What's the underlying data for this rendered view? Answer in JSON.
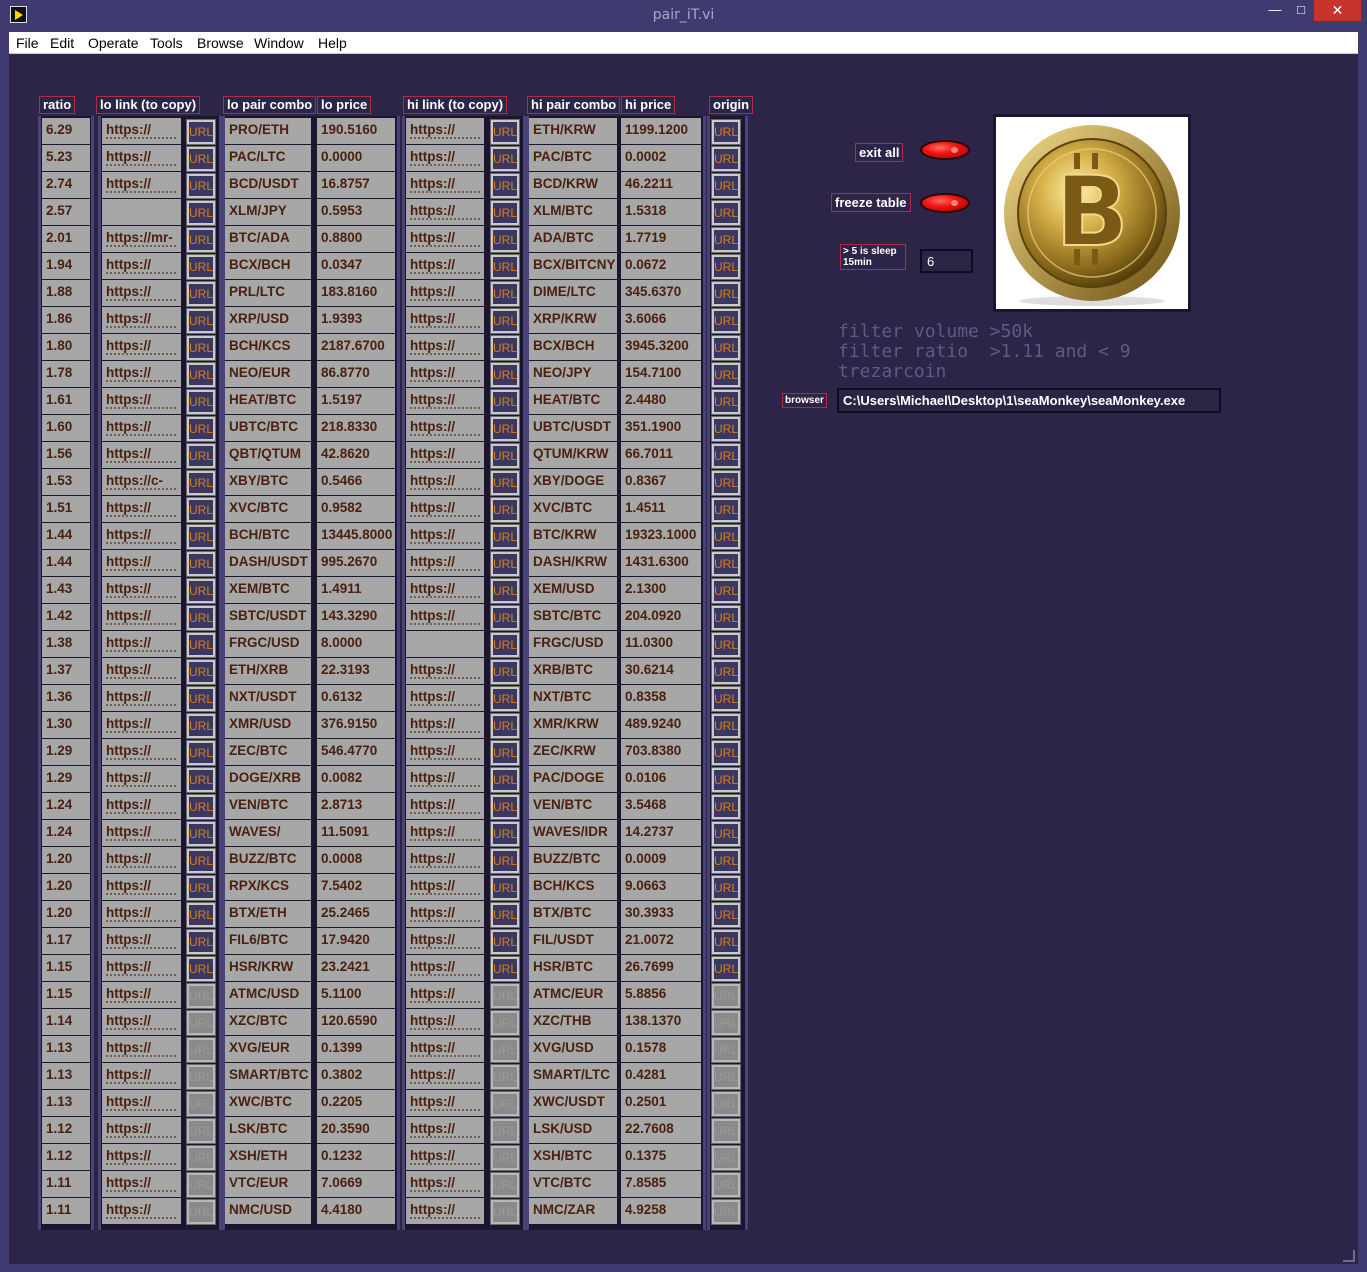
{
  "window": {
    "title": "pair_iT.vi",
    "minimize": "—",
    "maximize": "□",
    "close": "✕"
  },
  "menu": [
    "File",
    "Edit",
    "Operate",
    "Tools",
    "Browse",
    "Window",
    "Help"
  ],
  "columns": {
    "ratio": "ratio",
    "lo_link": "lo link (to copy)",
    "lo_pair": "lo pair combo",
    "lo_price": "lo price",
    "hi_link": "hi link (to copy)",
    "hi_pair": "hi pair combo",
    "hi_price": "hi price",
    "origin": "origin"
  },
  "url_label": "URL",
  "rows": [
    {
      "ratio": "6.29",
      "lo_link": "https://",
      "lo_pair": "PRO/ETH",
      "lo_price": "190.5160",
      "hi_link": "https://",
      "hi_pair": "ETH/KRW",
      "hi_price": "1199.1200",
      "active": true
    },
    {
      "ratio": "5.23",
      "lo_link": "https://",
      "lo_pair": "PAC/LTC",
      "lo_price": "0.0000",
      "hi_link": "https://",
      "hi_pair": "PAC/BTC",
      "hi_price": "0.0002",
      "active": true
    },
    {
      "ratio": "2.74",
      "lo_link": "https://",
      "lo_pair": "BCD/USDT",
      "lo_price": "16.8757",
      "hi_link": "https://",
      "hi_pair": "BCD/KRW",
      "hi_price": "46.2211",
      "active": true
    },
    {
      "ratio": "2.57",
      "lo_link": "",
      "lo_pair": "XLM/JPY",
      "lo_price": "0.5953",
      "hi_link": "https://",
      "hi_pair": "XLM/BTC",
      "hi_price": "1.5318",
      "active": true
    },
    {
      "ratio": "2.01",
      "lo_link": "https://mr-",
      "lo_pair": "BTC/ADA",
      "lo_price": "0.8800",
      "hi_link": "https://",
      "hi_pair": "ADA/BTC",
      "hi_price": "1.7719",
      "active": true
    },
    {
      "ratio": "1.94",
      "lo_link": "https://",
      "lo_pair": "BCX/BCH",
      "lo_price": "0.0347",
      "hi_link": "https://",
      "hi_pair": "BCX/BITCNY",
      "hi_price": "0.0672",
      "active": true
    },
    {
      "ratio": "1.88",
      "lo_link": "https://",
      "lo_pair": "PRL/LTC",
      "lo_price": "183.8160",
      "hi_link": "https://",
      "hi_pair": "DIME/LTC",
      "hi_price": "345.6370",
      "active": true
    },
    {
      "ratio": "1.86",
      "lo_link": "https://",
      "lo_pair": "XRP/USD",
      "lo_price": "1.9393",
      "hi_link": "https://",
      "hi_pair": "XRP/KRW",
      "hi_price": "3.6066",
      "active": true
    },
    {
      "ratio": "1.80",
      "lo_link": "https://",
      "lo_pair": "BCH/KCS",
      "lo_price": "2187.6700",
      "hi_link": "https://",
      "hi_pair": "BCX/BCH",
      "hi_price": "3945.3200",
      "active": true
    },
    {
      "ratio": "1.78",
      "lo_link": "https://",
      "lo_pair": "NEO/EUR",
      "lo_price": "86.8770",
      "hi_link": "https://",
      "hi_pair": "NEO/JPY",
      "hi_price": "154.7100",
      "active": true
    },
    {
      "ratio": "1.61",
      "lo_link": "https://",
      "lo_pair": "HEAT/BTC",
      "lo_price": "1.5197",
      "hi_link": "https://",
      "hi_pair": "HEAT/BTC",
      "hi_price": "2.4480",
      "active": true
    },
    {
      "ratio": "1.60",
      "lo_link": "https://",
      "lo_pair": "UBTC/BTC",
      "lo_price": "218.8330",
      "hi_link": "https://",
      "hi_pair": "UBTC/USDT",
      "hi_price": "351.1900",
      "active": true
    },
    {
      "ratio": "1.56",
      "lo_link": "https://",
      "lo_pair": "QBT/QTUM",
      "lo_price": "42.8620",
      "hi_link": "https://",
      "hi_pair": "QTUM/KRW",
      "hi_price": "66.7011",
      "active": true
    },
    {
      "ratio": "1.53",
      "lo_link": "https://c-",
      "lo_pair": "XBY/BTC",
      "lo_price": "0.5466",
      "hi_link": "https://",
      "hi_pair": "XBY/DOGE",
      "hi_price": "0.8367",
      "active": true
    },
    {
      "ratio": "1.51",
      "lo_link": "https://",
      "lo_pair": "XVC/BTC",
      "lo_price": "0.9582",
      "hi_link": "https://",
      "hi_pair": "XVC/BTC",
      "hi_price": "1.4511",
      "active": true
    },
    {
      "ratio": "1.44",
      "lo_link": "https://",
      "lo_pair": "BCH/BTC",
      "lo_price": "13445.8000",
      "hi_link": "https://",
      "hi_pair": "BTC/KRW",
      "hi_price": "19323.1000",
      "active": true
    },
    {
      "ratio": "1.44",
      "lo_link": "https://",
      "lo_pair": "DASH/USDT",
      "lo_price": "995.2670",
      "hi_link": "https://",
      "hi_pair": "DASH/KRW",
      "hi_price": "1431.6300",
      "active": true
    },
    {
      "ratio": "1.43",
      "lo_link": "https://",
      "lo_pair": "XEM/BTC",
      "lo_price": "1.4911",
      "hi_link": "https://",
      "hi_pair": "XEM/USD",
      "hi_price": "2.1300",
      "active": true
    },
    {
      "ratio": "1.42",
      "lo_link": "https://",
      "lo_pair": "SBTC/USDT",
      "lo_price": "143.3290",
      "hi_link": "https://",
      "hi_pair": "SBTC/BTC",
      "hi_price": "204.0920",
      "active": true
    },
    {
      "ratio": "1.38",
      "lo_link": "https://",
      "lo_pair": "FRGC/USD",
      "lo_price": "8.0000",
      "hi_link": "",
      "hi_pair": "FRGC/USD",
      "hi_price": "11.0300",
      "active": true
    },
    {
      "ratio": "1.37",
      "lo_link": "https://",
      "lo_pair": "ETH/XRB",
      "lo_price": "22.3193",
      "hi_link": "https://",
      "hi_pair": "XRB/BTC",
      "hi_price": "30.6214",
      "active": true
    },
    {
      "ratio": "1.36",
      "lo_link": "https://",
      "lo_pair": "NXT/USDT",
      "lo_price": "0.6132",
      "hi_link": "https://",
      "hi_pair": "NXT/BTC",
      "hi_price": "0.8358",
      "active": true
    },
    {
      "ratio": "1.30",
      "lo_link": "https://",
      "lo_pair": "XMR/USD",
      "lo_price": "376.9150",
      "hi_link": "https://",
      "hi_pair": "XMR/KRW",
      "hi_price": "489.9240",
      "active": true
    },
    {
      "ratio": "1.29",
      "lo_link": "https://",
      "lo_pair": "ZEC/BTC",
      "lo_price": "546.4770",
      "hi_link": "https://",
      "hi_pair": "ZEC/KRW",
      "hi_price": "703.8380",
      "active": true
    },
    {
      "ratio": "1.29",
      "lo_link": "https://",
      "lo_pair": "DOGE/XRB",
      "lo_price": "0.0082",
      "hi_link": "https://",
      "hi_pair": "PAC/DOGE",
      "hi_price": "0.0106",
      "active": true
    },
    {
      "ratio": "1.24",
      "lo_link": "https://",
      "lo_pair": "VEN/BTC",
      "lo_price": "2.8713",
      "hi_link": "https://",
      "hi_pair": "VEN/BTC",
      "hi_price": "3.5468",
      "active": true
    },
    {
      "ratio": "1.24",
      "lo_link": "https://",
      "lo_pair": "WAVES/",
      "lo_price": "11.5091",
      "hi_link": "https://",
      "hi_pair": "WAVES/IDR",
      "hi_price": "14.2737",
      "active": true
    },
    {
      "ratio": "1.20",
      "lo_link": "https://",
      "lo_pair": "BUZZ/BTC",
      "lo_price": "0.0008",
      "hi_link": "https://",
      "hi_pair": "BUZZ/BTC",
      "hi_price": "0.0009",
      "active": true
    },
    {
      "ratio": "1.20",
      "lo_link": "https://",
      "lo_pair": "RPX/KCS",
      "lo_price": "7.5402",
      "hi_link": "https://",
      "hi_pair": "BCH/KCS",
      "hi_price": "9.0663",
      "active": true
    },
    {
      "ratio": "1.20",
      "lo_link": "https://",
      "lo_pair": "BTX/ETH",
      "lo_price": "25.2465",
      "hi_link": "https://",
      "hi_pair": "BTX/BTC",
      "hi_price": "30.3933",
      "active": true
    },
    {
      "ratio": "1.17",
      "lo_link": "https://",
      "lo_pair": "FIL6/BTC",
      "lo_price": "17.9420",
      "hi_link": "https://",
      "hi_pair": "FIL/USDT",
      "hi_price": "21.0072",
      "active": true
    },
    {
      "ratio": "1.15",
      "lo_link": "https://",
      "lo_pair": "HSR/KRW",
      "lo_price": "23.2421",
      "hi_link": "https://",
      "hi_pair": "HSR/BTC",
      "hi_price": "26.7699",
      "active": true
    },
    {
      "ratio": "1.15",
      "lo_link": "https://",
      "lo_pair": "ATMC/USD",
      "lo_price": "5.1100",
      "hi_link": "https://",
      "hi_pair": "ATMC/EUR",
      "hi_price": "5.8856",
      "active": false
    },
    {
      "ratio": "1.14",
      "lo_link": "https://",
      "lo_pair": "XZC/BTC",
      "lo_price": "120.6590",
      "hi_link": "https://",
      "hi_pair": "XZC/THB",
      "hi_price": "138.1370",
      "active": false
    },
    {
      "ratio": "1.13",
      "lo_link": "https://",
      "lo_pair": "XVG/EUR",
      "lo_price": "0.1399",
      "hi_link": "https://",
      "hi_pair": "XVG/USD",
      "hi_price": "0.1578",
      "active": false
    },
    {
      "ratio": "1.13",
      "lo_link": "https://",
      "lo_pair": "SMART/BTC",
      "lo_price": "0.3802",
      "hi_link": "https://",
      "hi_pair": "SMART/LTC",
      "hi_price": "0.4281",
      "active": false
    },
    {
      "ratio": "1.13",
      "lo_link": "https://",
      "lo_pair": "XWC/BTC",
      "lo_price": "0.2205",
      "hi_link": "https://",
      "hi_pair": "XWC/USDT",
      "hi_price": "0.2501",
      "active": false
    },
    {
      "ratio": "1.12",
      "lo_link": "https://",
      "lo_pair": "LSK/BTC",
      "lo_price": "20.3590",
      "hi_link": "https://",
      "hi_pair": "LSK/USD",
      "hi_price": "22.7608",
      "active": false
    },
    {
      "ratio": "1.12",
      "lo_link": "https://",
      "lo_pair": "XSH/ETH",
      "lo_price": "0.1232",
      "hi_link": "https://",
      "hi_pair": "XSH/BTC",
      "hi_price": "0.1375",
      "active": false
    },
    {
      "ratio": "1.11",
      "lo_link": "https://",
      "lo_pair": "VTC/EUR",
      "lo_price": "7.0669",
      "hi_link": "https://",
      "hi_pair": "VTC/BTC",
      "hi_price": "7.8585",
      "active": false
    },
    {
      "ratio": "1.11",
      "lo_link": "https://",
      "lo_pair": "NMC/USD",
      "lo_price": "4.4180",
      "hi_link": "https://",
      "hi_pair": "NMC/ZAR",
      "hi_price": "4.9258",
      "active": false
    }
  ],
  "controls": {
    "exit_all": "exit all",
    "freeze_table": "freeze table",
    "sleep_label": "> 5 is sleep 15min",
    "sleep_value": "6",
    "notes": [
      "filter volume >50k",
      "filter ratio  >1.11 and < 9",
      "trezarcoin"
    ],
    "browser_label": "browser",
    "browser_path": "C:\\Users\\Michael\\Desktop\\1\\seaMonkey\\seaMonkey.exe"
  },
  "colors": {
    "panel": "#2c2548",
    "cell": "#a7a7a7",
    "cell_text": "#4a2010",
    "label_border": "#b22847",
    "led": "#ee1515",
    "url_text": "#dc7d17"
  }
}
